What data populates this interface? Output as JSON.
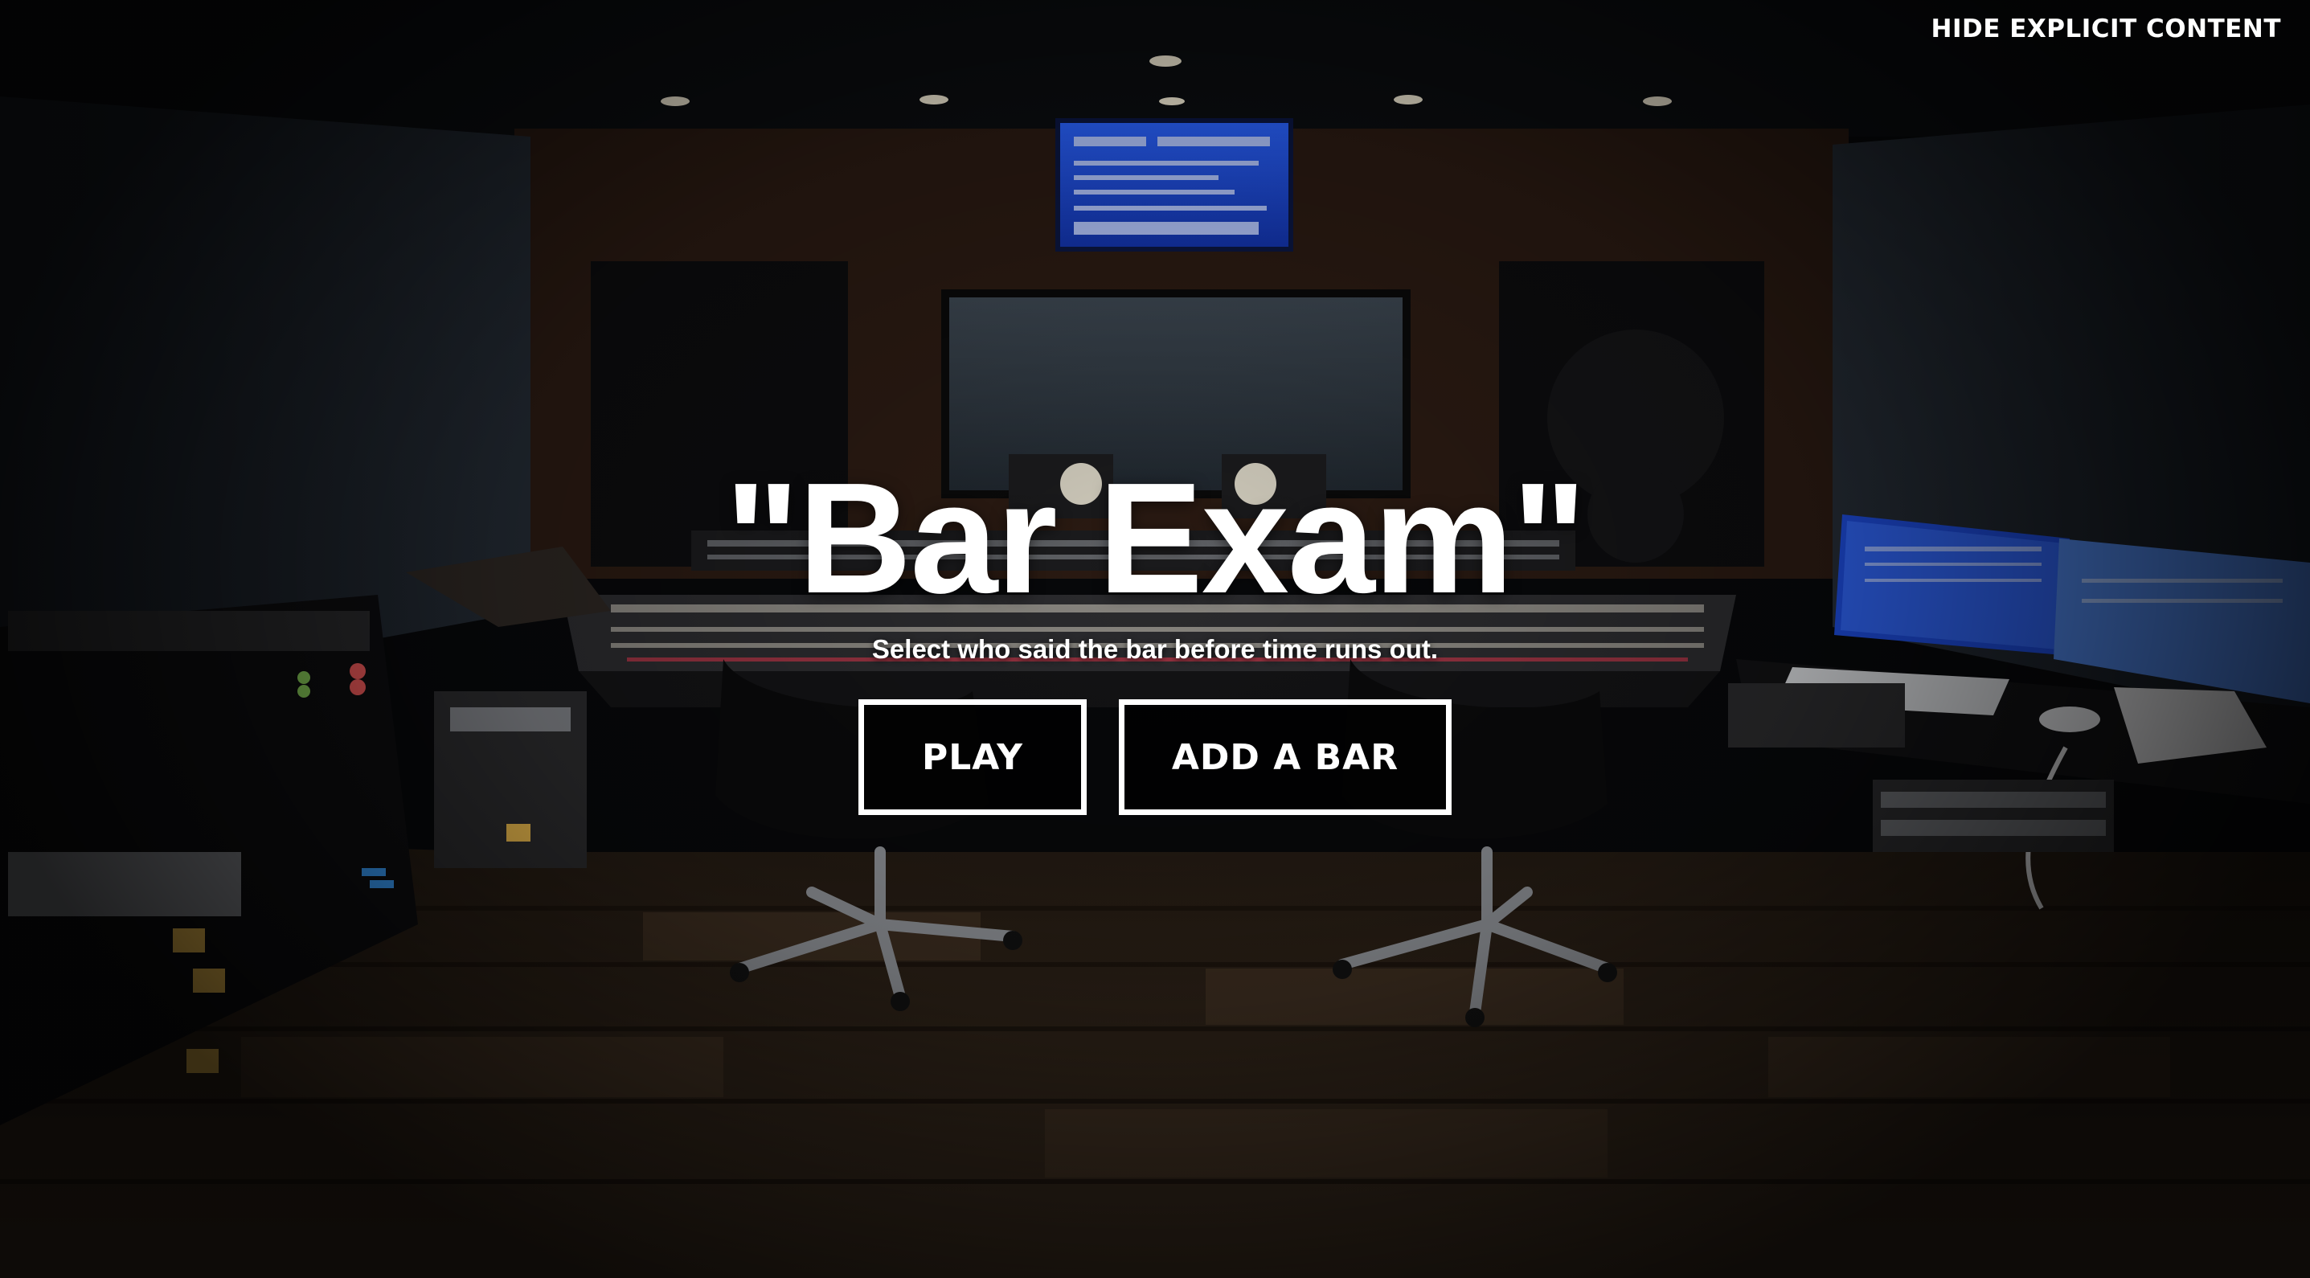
{
  "header": {
    "hide_explicit_label": "HIDE EXPLICIT CONTENT"
  },
  "hero": {
    "title": "\"Bar Exam\"",
    "subtitle": "Select who said the bar before time runs out."
  },
  "buttons": {
    "play_label": "PLAY",
    "add_bar_label": "ADD A BAR"
  },
  "background": {
    "description_icon": "recording-studio-background-image"
  },
  "colors": {
    "text": "#ffffff",
    "overlay": "#000000",
    "monitor_glow": "#1f4fd8"
  }
}
